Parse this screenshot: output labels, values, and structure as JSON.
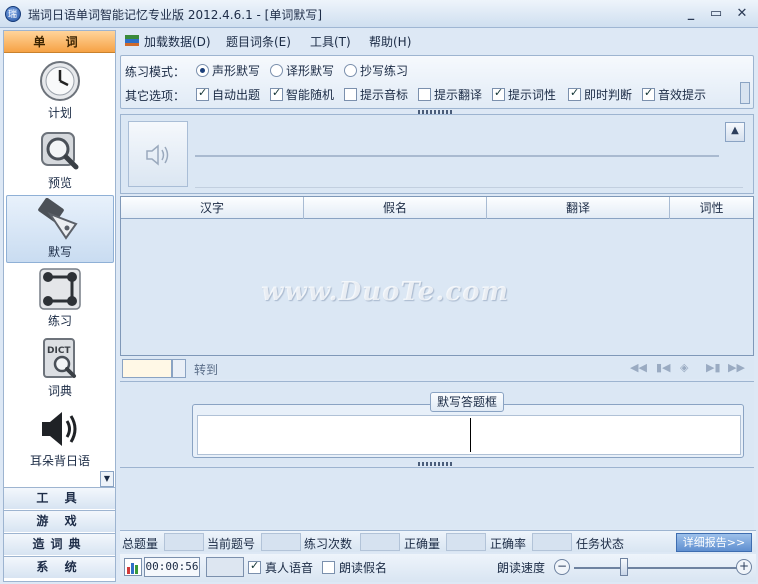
{
  "window": {
    "title": "瑞词日语单词智能记忆专业版 2012.4.6.1 - [单词默写]",
    "controls": {
      "minimize": "_",
      "maximize": "▭",
      "close": "✕"
    }
  },
  "sidebar": {
    "header": "单 词",
    "items": [
      {
        "label": "计划",
        "icon": "clock-icon"
      },
      {
        "label": "预览",
        "icon": "magnifier-icon"
      },
      {
        "label": "默写",
        "icon": "pen-nib-icon"
      },
      {
        "label": "练习",
        "icon": "connect-dots-icon"
      },
      {
        "label": "词典",
        "icon": "dict-book-icon"
      },
      {
        "label": "耳朵背日语",
        "icon": "speaker-icon"
      }
    ],
    "categories": [
      "工 具",
      "游 戏",
      "造词典",
      "系 统"
    ]
  },
  "menu": {
    "load": "加载数据(D)",
    "entries": "题目词条(E)",
    "tools": "工具(T)",
    "help": "帮助(H)"
  },
  "options": {
    "mode_label": "练习模式：",
    "modes": [
      {
        "label": "声形默写",
        "selected": true
      },
      {
        "label": "译形默写",
        "selected": false
      },
      {
        "label": "抄写练习",
        "selected": false
      }
    ],
    "other_label": "其它选项：",
    "checks": [
      {
        "label": "自动出题",
        "checked": true
      },
      {
        "label": "智能随机",
        "checked": true
      },
      {
        "label": "提示音标",
        "checked": false
      },
      {
        "label": "提示翻译",
        "checked": false
      },
      {
        "label": "提示词性",
        "checked": true
      },
      {
        "label": "即时判断",
        "checked": true
      },
      {
        "label": "音效提示",
        "checked": true
      }
    ]
  },
  "grid": {
    "columns": [
      "汉字",
      "假名",
      "翻译",
      "词性"
    ],
    "watermark": "www.DuoTe.com"
  },
  "nav": {
    "goto": "转到"
  },
  "answer": {
    "label": "默写答题框"
  },
  "stats": {
    "labels": [
      "总题量",
      "当前题号",
      "练习次数",
      "正确量",
      "正确率",
      "任务状态"
    ],
    "detail_button": "详细报告>>"
  },
  "bottom": {
    "time": "00:00:56",
    "real_voice": {
      "label": "真人语音",
      "checked": true
    },
    "read_kana": {
      "label": "朗读假名",
      "checked": false
    },
    "speed_label": "朗读速度"
  },
  "colors": {
    "accent": "#f6a245",
    "panel": "#dbe7f4",
    "border": "#9db4d0"
  }
}
